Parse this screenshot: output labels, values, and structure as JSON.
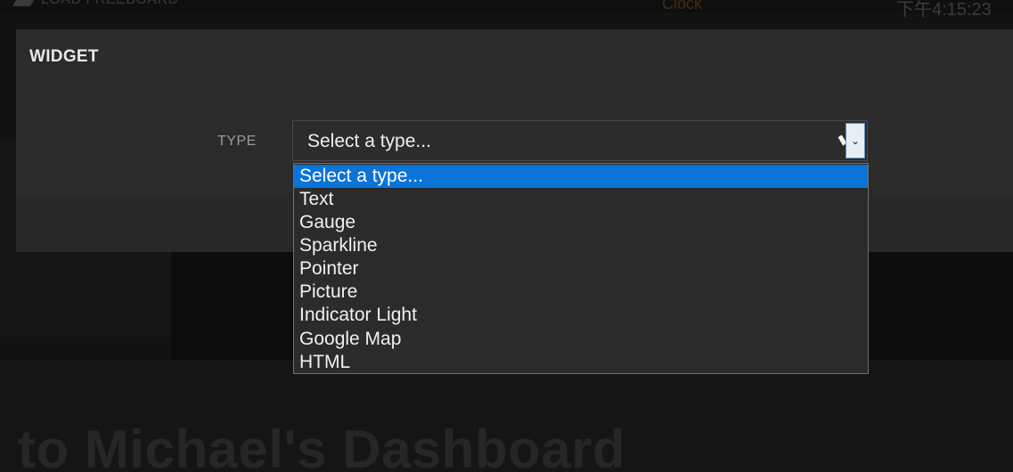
{
  "background": {
    "load_button_label": "LOAD FREEBOARD",
    "clock_label": "Clock",
    "time_text": "下午4:15:23",
    "heading": "to Michael's Dashboard"
  },
  "modal": {
    "title": "WIDGET",
    "type_label": "TYPE",
    "select": {
      "value": "Select a type...",
      "options": [
        "Select a type...",
        "Text",
        "Gauge",
        "Sparkline",
        "Pointer",
        "Picture",
        "Indicator Light",
        "Google Map",
        "HTML"
      ],
      "selected_index": 0,
      "highlight_color": "#0a74d8",
      "icon": "chevron-down-icon"
    }
  }
}
